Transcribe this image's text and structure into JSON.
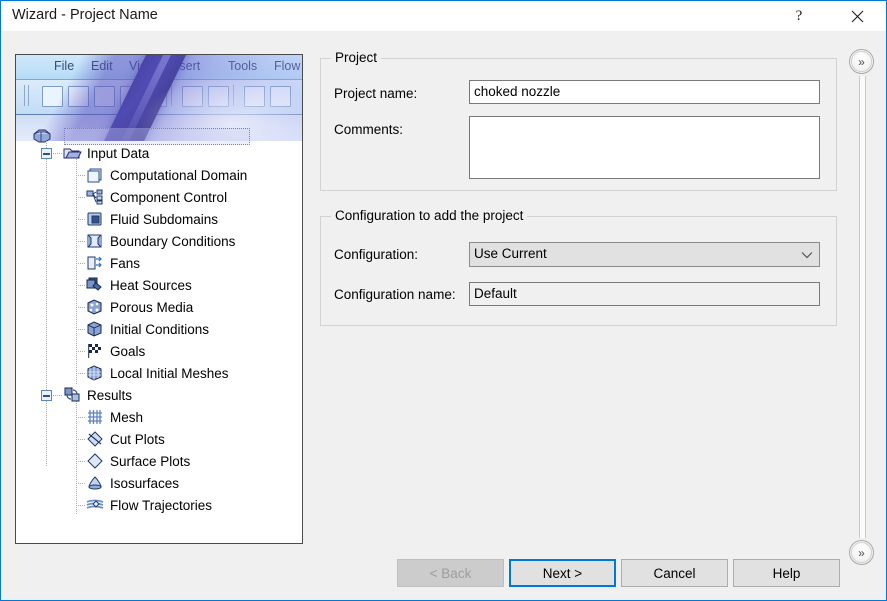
{
  "window": {
    "title": "Wizard - Project Name",
    "help_label": "?",
    "close_label": "✕",
    "accent_color": "#0078d7",
    "background_color": "#f0f0f0"
  },
  "tree_banner": {
    "menu_items": [
      "File",
      "Edit",
      "View",
      "Insert",
      "Tools",
      "Flow"
    ],
    "alt": "decorative toolbar screenshot with pen"
  },
  "tree": {
    "root_label": "",
    "nodes": [
      {
        "label": "Input Data",
        "icon": "input-data-folder-icon",
        "level": 1,
        "expander": "collapse"
      },
      {
        "label": "Computational Domain",
        "icon": "computational-domain-icon",
        "level": 2
      },
      {
        "label": "Component Control",
        "icon": "component-control-icon",
        "level": 2
      },
      {
        "label": "Fluid Subdomains",
        "icon": "fluid-subdomains-icon",
        "level": 2
      },
      {
        "label": "Boundary Conditions",
        "icon": "boundary-conditions-icon",
        "level": 2
      },
      {
        "label": "Fans",
        "icon": "fans-icon",
        "level": 2
      },
      {
        "label": "Heat Sources",
        "icon": "heat-sources-icon",
        "level": 2
      },
      {
        "label": "Porous Media",
        "icon": "porous-media-icon",
        "level": 2
      },
      {
        "label": "Initial Conditions",
        "icon": "initial-conditions-icon",
        "level": 2
      },
      {
        "label": "Goals",
        "icon": "goals-flag-icon",
        "level": 2
      },
      {
        "label": "Local Initial Meshes",
        "icon": "local-initial-meshes-icon",
        "level": 2
      },
      {
        "label": "Results",
        "icon": "results-icon",
        "level": 1,
        "expander": "collapse"
      },
      {
        "label": "Mesh",
        "icon": "mesh-grid-icon",
        "level": 2
      },
      {
        "label": "Cut Plots",
        "icon": "cut-plots-icon",
        "level": 2
      },
      {
        "label": "Surface Plots",
        "icon": "surface-plots-icon",
        "level": 2
      },
      {
        "label": "Isosurfaces",
        "icon": "isosurfaces-icon",
        "level": 2
      },
      {
        "label": "Flow Trajectories",
        "icon": "flow-trajectories-icon",
        "level": 2
      }
    ]
  },
  "project_group": {
    "title": "Project",
    "project_name_label": "Project name:",
    "project_name_value": "choked nozzle",
    "project_name_placeholder": "",
    "comments_label": "Comments:",
    "comments_value": "",
    "comments_placeholder": ""
  },
  "configuration_group": {
    "title": "Configuration to add the project",
    "configuration_label": "Configuration:",
    "configuration_value": "Use Current",
    "configuration_options": [
      "Use Current"
    ],
    "configuration_name_label": "Configuration name:",
    "configuration_name_value": "Default"
  },
  "footer": {
    "back_label": "< Back",
    "next_label": "Next >",
    "cancel_label": "Cancel",
    "help_label": "Help"
  },
  "rail": {
    "top_label": "»",
    "bottom_label": "»"
  }
}
